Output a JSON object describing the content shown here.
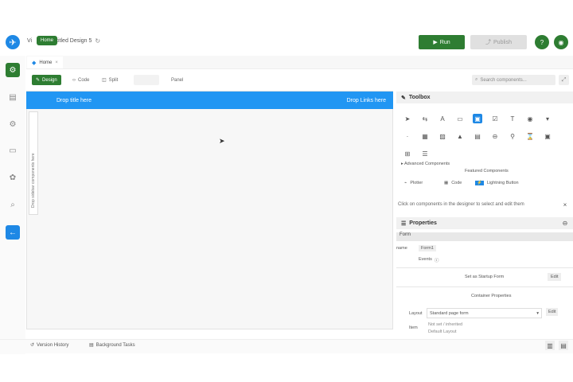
{
  "app": {
    "title_prefix": "Vi",
    "doc_name": "Untitled Design 5",
    "tooltip": "Home"
  },
  "header": {
    "run_label": "Run",
    "publish_label": "Publish"
  },
  "tabs": [
    {
      "label": "Home"
    }
  ],
  "viewbar": {
    "design_label": "Design",
    "code_label": "Code",
    "split_label": "Split",
    "panel_label": "Panel",
    "search_placeholder": "Search components..."
  },
  "canvas": {
    "drop_left": "Drop title here",
    "drop_right": "Drop Links here",
    "side_label": "Drop sidebar components here"
  },
  "toolbox": {
    "title": "Toolbox",
    "more_label": "▸ Advanced Components",
    "featured_label": "Featured Components",
    "featured": [
      "Plotter",
      "Code",
      "Lightning Button"
    ],
    "hint": "Click on components in the designer to select and edit them"
  },
  "properties": {
    "title": "Properties",
    "form_label": "Form",
    "name_key": "name",
    "name_value": "Form1",
    "events_label": "Events",
    "action_label": "Set as Startup Form",
    "action_btn": "Edit",
    "container_label": "Container Properties",
    "select_key": "Layout",
    "select_value": "Standard page form",
    "edit_btn": "Edit",
    "type_key": "Item",
    "type_line1": "Not set / inherited",
    "type_line2": "Default Layout"
  },
  "bottom": {
    "history_label": "Version History",
    "tasks_label": "Background Tasks"
  },
  "colors": {
    "accent": "#2e7d32",
    "drop": "#2196f3",
    "brand": "#1e88e5"
  }
}
